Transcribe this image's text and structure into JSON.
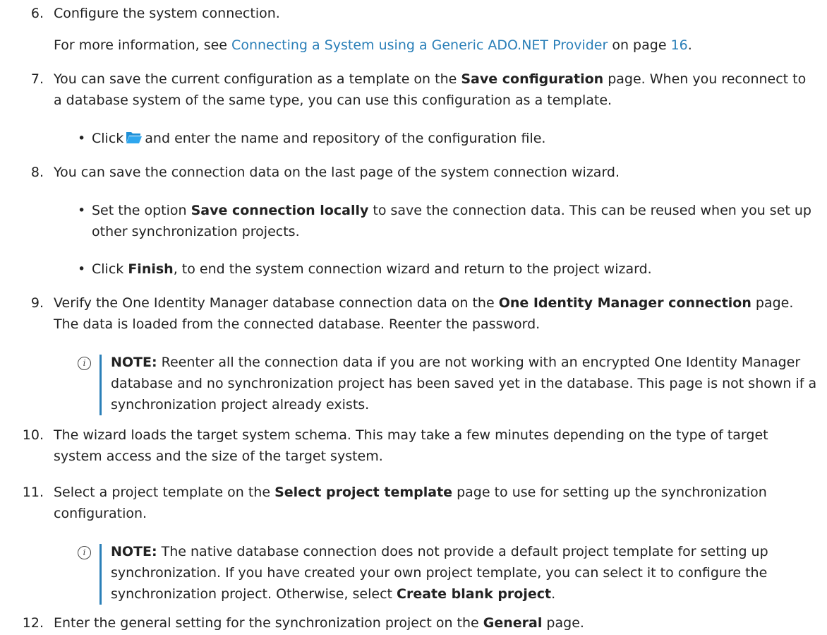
{
  "steps": {
    "s6": {
      "num": "6.",
      "text": "Configure the system connection.",
      "more_pre": "For more information, see ",
      "more_link": "Connecting a System using a Generic ADO.NET Provider",
      "more_mid": " on page ",
      "more_page": "16",
      "more_post": "."
    },
    "s7": {
      "num": "7.",
      "pre": "You can save the current configuration as a template on the ",
      "bold": "Save configuration",
      "post": " page. When you reconnect to a database system of the same type, you can use this configuration as a template.",
      "bullet_pre": "Click",
      "bullet_post": "and enter the name and repository of the configuration file."
    },
    "s8": {
      "num": "8.",
      "text": "You can save the connection data on the last page of the system connection wizard.",
      "b1_pre": "Set the option ",
      "b1_bold": "Save connection locally",
      "b1_post": " to save the connection data. This can be reused when you set up other synchronization projects.",
      "b2_pre": "Click ",
      "b2_bold": "Finish",
      "b2_post": ", to end the system connection wizard and return to the project wizard."
    },
    "s9": {
      "num": "9.",
      "pre": "Verify the One Identity Manager database connection data on the ",
      "bold": "One Identity Manager connection",
      "post": " page. The data is loaded from the connected database. Reenter the password.",
      "note_label": "NOTE:",
      "note_text": " Reenter all the connection data if you are not working with an encrypted One Identity Manager database and no synchronization project has been saved yet in the database. This page is not shown if a synchronization project already exists."
    },
    "s10": {
      "num": "10.",
      "text": "The wizard loads the target system schema. This may take a few minutes depending on the type of target system access and the size of the target system."
    },
    "s11": {
      "num": "11.",
      "pre": "Select a project template on the ",
      "bold": "Select project template",
      "post": " page to use for setting up the synchronization configuration.",
      "note_label": "NOTE:",
      "note_pre": " The native database connection does not provide a default project template for setting up synchronization. If you have created your own project template, you can select it to configure the synchronization project. Otherwise, select ",
      "note_bold": "Create blank project",
      "note_post": "."
    },
    "s12": {
      "num": "12.",
      "pre": "Enter the general setting for the synchronization project on the ",
      "bold": "General",
      "post": " page."
    }
  },
  "bullet_glyph": "•",
  "note_icon_glyph": "i",
  "colors": {
    "link": "#2a7fb8",
    "note_bar": "#2a7fb8",
    "folder_icon": "#1e8fd6",
    "text": "#222222"
  }
}
